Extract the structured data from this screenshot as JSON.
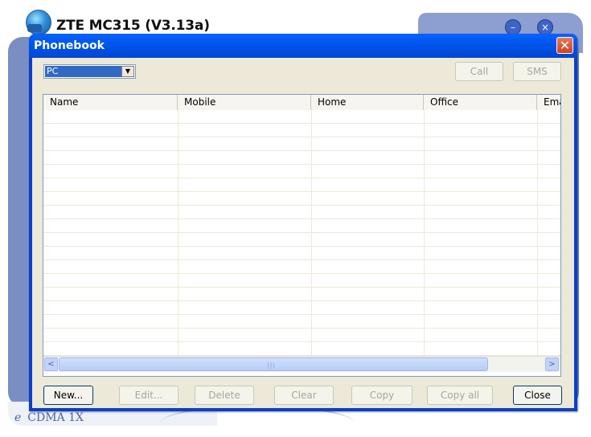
{
  "background_app": {
    "title": "ZTE MC315 (V3.13a)",
    "status_icon": "e",
    "status_text": "CDMA 1X",
    "icons": [
      "globe-app-icon",
      "minimize-icon",
      "close-icon"
    ]
  },
  "dialog": {
    "title": "Phonebook",
    "close_label": "✕",
    "storage_select": {
      "value": "PC",
      "arrow": "▼"
    },
    "call_label": "Call",
    "sms_label": "SMS",
    "columns": [
      "Name",
      "Mobile",
      "Home",
      "Office",
      "Ema"
    ],
    "rows": [],
    "scroll_left": "<",
    "scroll_right": ">",
    "scroll_grip": "|||",
    "buttons": {
      "new": "New...",
      "edit": "Edit...",
      "delete": "Delete",
      "clear": "Clear",
      "copy": "Copy",
      "copy_all": "Copy all",
      "close": "Close"
    }
  },
  "colors": {
    "titlebar": "#0058ee",
    "client": "#ece9d8",
    "selection": "#316ac5",
    "close_button": "#d1401c"
  }
}
